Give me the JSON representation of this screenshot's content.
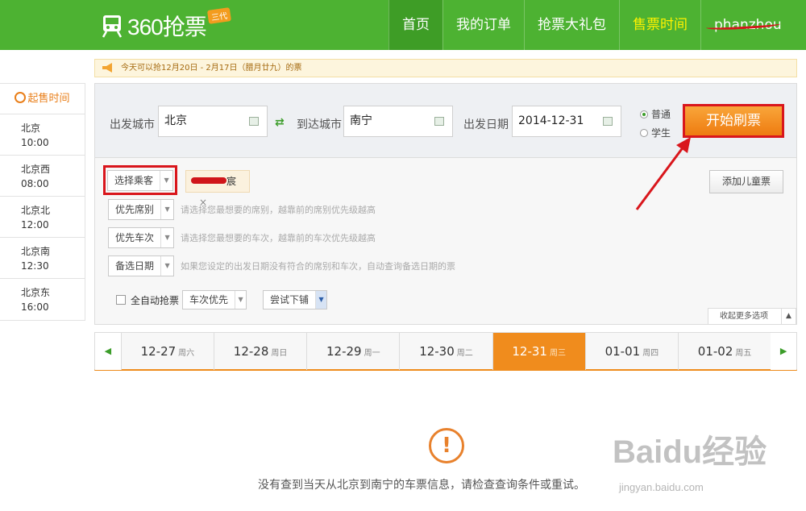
{
  "header": {
    "logo_text": "360抢票",
    "logo_badge": "三代",
    "nav": [
      {
        "label": "首页"
      },
      {
        "label": "我的订单"
      },
      {
        "label": "抢票大礼包"
      },
      {
        "label": "售票时间"
      },
      {
        "label": "phanzhou"
      }
    ]
  },
  "notice": {
    "text": "今天可以抢12月20日 - 2月17日（腊月廿九）的票"
  },
  "sidebar": {
    "title": "起售时间",
    "items": [
      {
        "station": "北京",
        "time": "10:00"
      },
      {
        "station": "北京西",
        "time": "08:00"
      },
      {
        "station": "北京北",
        "time": "12:00"
      },
      {
        "station": "北京南",
        "time": "12:30"
      },
      {
        "station": "北京东",
        "time": "16:00"
      }
    ]
  },
  "search": {
    "from_label": "出发城市",
    "from_value": "北京",
    "to_label": "到达城市",
    "to_value": "南宁",
    "date_label": "出发日期",
    "date_value": "2014-12-31",
    "ticket_types": [
      {
        "label": "普通",
        "checked": true
      },
      {
        "label": "学生",
        "checked": false
      }
    ],
    "start_button": "开始刷票"
  },
  "options": {
    "passenger_select": "选择乘客",
    "passenger_tag_suffix": "宸",
    "add_child_button": "添加儿童票",
    "seat_pref": "优先席别",
    "seat_hint": "请选择您最想要的席别，越靠前的席别优先级越高",
    "train_pref": "优先车次",
    "train_hint": "请选择您最想要的车次，越靠前的车次优先级越高",
    "backup_date": "备选日期",
    "backup_hint": "如果您设定的出发日期没有符合的席别和车次，自动查询备选日期的票",
    "auto_label": "全自动抢票",
    "auto_mode": "车次优先",
    "lower_berth": "尝试下铺",
    "collapse": "收起更多选项"
  },
  "dates": [
    {
      "date": "12-27",
      "weekday": "周六",
      "active": false
    },
    {
      "date": "12-28",
      "weekday": "周日",
      "active": false
    },
    {
      "date": "12-29",
      "weekday": "周一",
      "active": false
    },
    {
      "date": "12-30",
      "weekday": "周二",
      "active": false
    },
    {
      "date": "12-31",
      "weekday": "周三",
      "active": true
    },
    {
      "date": "01-01",
      "weekday": "周四",
      "active": false
    },
    {
      "date": "01-02",
      "weekday": "周五",
      "active": false
    }
  ],
  "empty": {
    "icon": "!",
    "message": "没有查到当天从北京到南宁的车票信息，请检查查询条件或重试。"
  },
  "watermark": {
    "brand": "Baidu经验",
    "url": "jingyan.baidu.com"
  },
  "colors": {
    "header_green": "#4db232",
    "accent_orange": "#f08c1d",
    "highlight_red": "#d9161c"
  }
}
